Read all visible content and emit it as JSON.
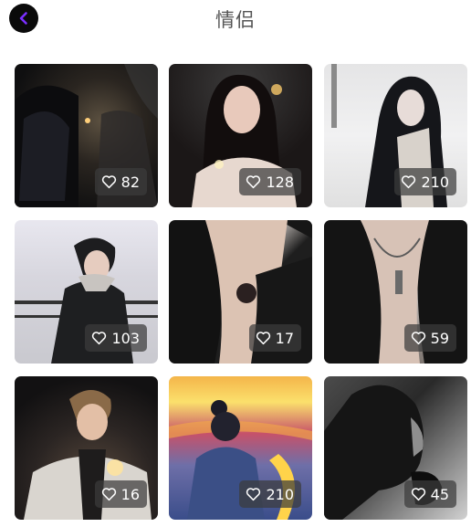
{
  "header": {
    "title": "情侣",
    "back_icon": "chevron-left-icon",
    "back_icon_color": "#7b2fff"
  },
  "gallery": {
    "items": [
      {
        "likes": "82"
      },
      {
        "likes": "128"
      },
      {
        "likes": "210"
      },
      {
        "likes": "103"
      },
      {
        "likes": "17"
      },
      {
        "likes": "59"
      },
      {
        "likes": "16"
      },
      {
        "likes": "210"
      },
      {
        "likes": "45"
      }
    ],
    "like_icon": "heart-outline-icon"
  }
}
